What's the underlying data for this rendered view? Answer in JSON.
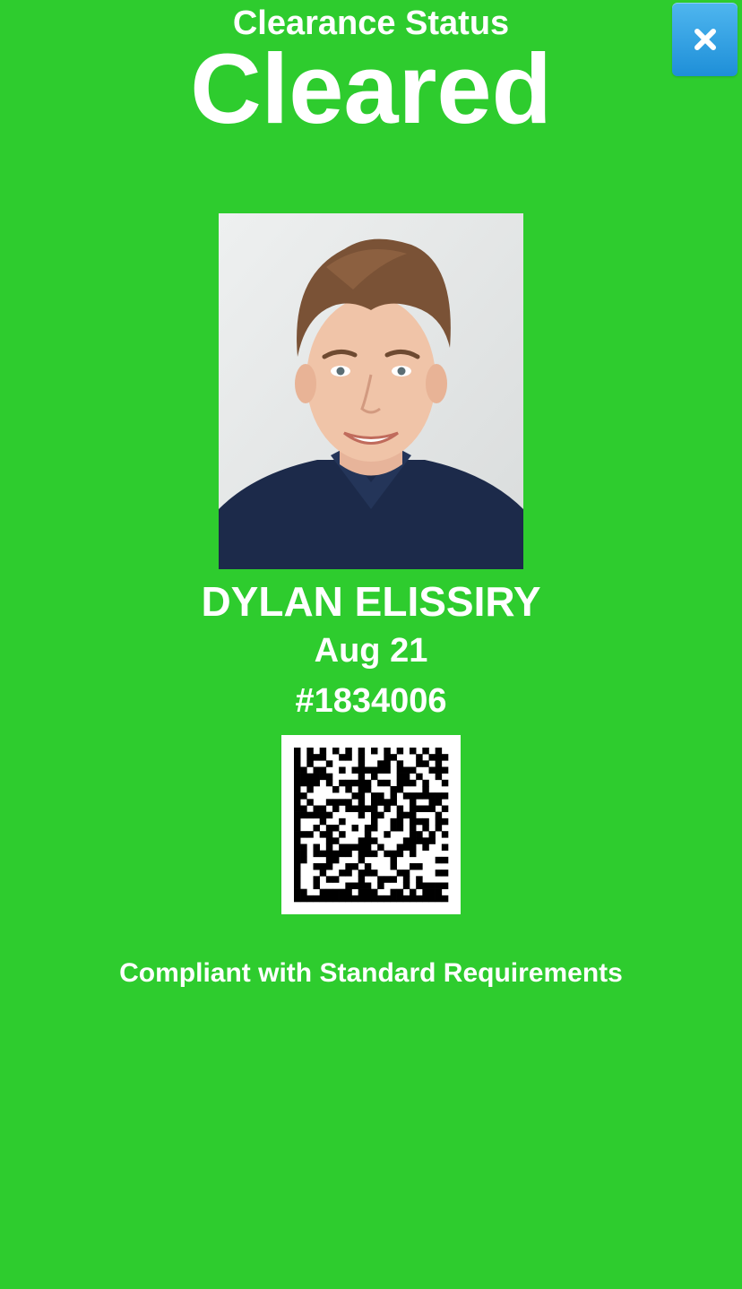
{
  "header": {
    "status_label": "Clearance Status",
    "status_value": "Cleared"
  },
  "close_button": {
    "icon": "close-icon"
  },
  "profile": {
    "photo_icon": "user-photo",
    "name": "DYLAN ELISSIRY",
    "date": "Aug 21",
    "id_number": "#1834006"
  },
  "barcode": {
    "icon": "data-matrix-code"
  },
  "footer": {
    "compliance_text": "Compliant with Standard Requirements"
  },
  "colors": {
    "background": "#2ecc2e",
    "text": "#ffffff",
    "close_button": "#2a9fe3"
  }
}
